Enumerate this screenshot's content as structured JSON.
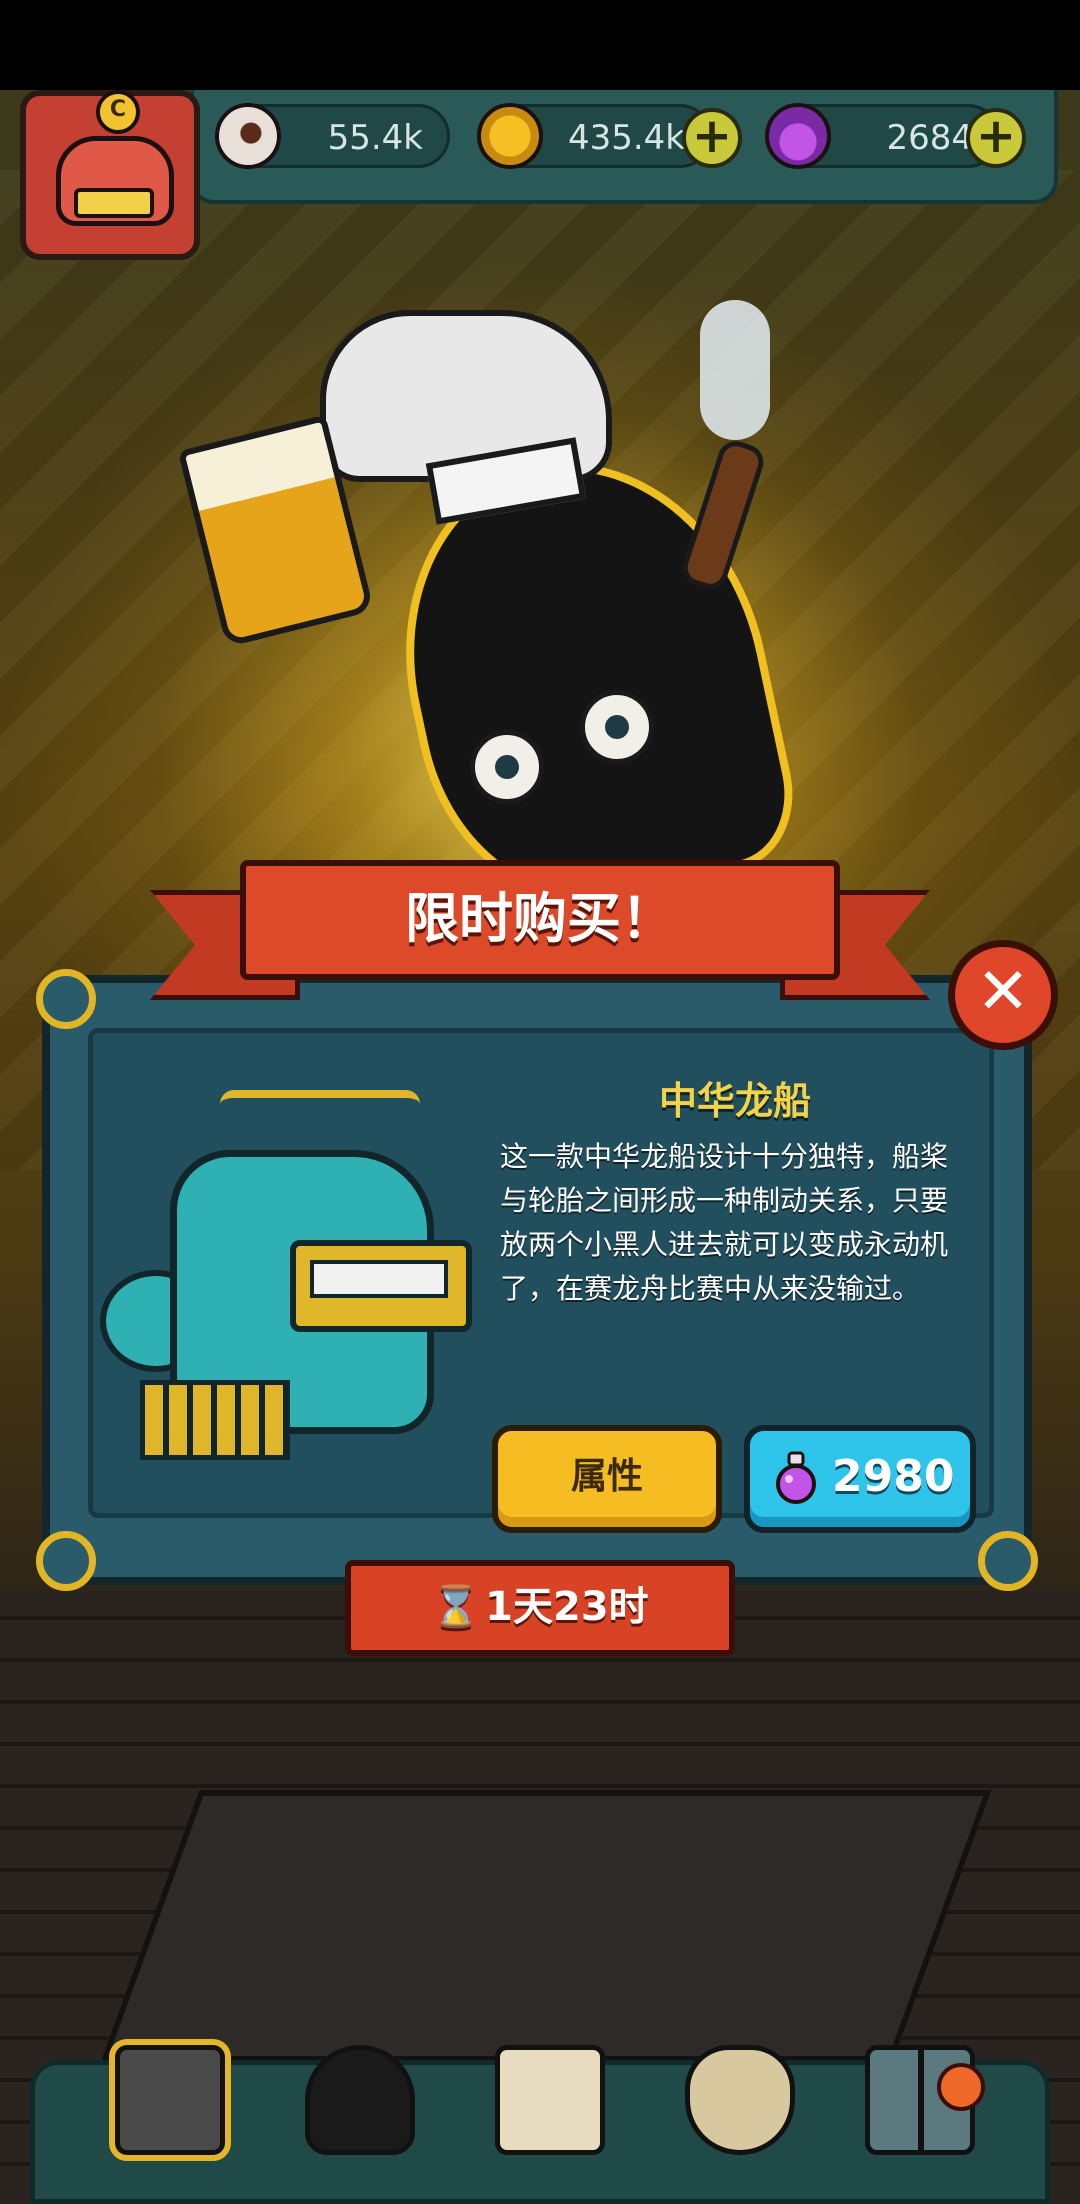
{
  "resources": {
    "eyeballs": "55.4k",
    "coins": "435.4k",
    "potions": "2684"
  },
  "popup": {
    "banner_title": "限时购买！",
    "item_name": "中华龙船",
    "item_description": "这一款中华龙船设计十分独特，船桨与轮胎之间形成一种制动关系，只要放两个小黑人进去就可以变成永动机了，在赛龙舟比赛中从来没输过。",
    "attributes_button": "属性",
    "price": "2980",
    "countdown": "1天23时",
    "close_symbol": "✕"
  },
  "avatar_badge": "C",
  "plus_symbol": "+",
  "hourglass_symbol": "⌛",
  "colors": {
    "banner_red": "#dd4a2a",
    "dialog_teal": "#2a5b6b",
    "title_yellow": "#f3d34a",
    "attr_button_yellow": "#f6bd22",
    "buy_button_blue": "#2fc4ea"
  },
  "bottom_nav": [
    {
      "name": "shop",
      "icon": "shop-icon",
      "active": true
    },
    {
      "name": "characters",
      "icon": "monster-icon",
      "active": false
    },
    {
      "name": "book",
      "icon": "book-icon",
      "active": false
    },
    {
      "name": "bag",
      "icon": "money-bag-icon",
      "active": false
    },
    {
      "name": "rooms",
      "icon": "grid-icon",
      "active": false
    }
  ]
}
